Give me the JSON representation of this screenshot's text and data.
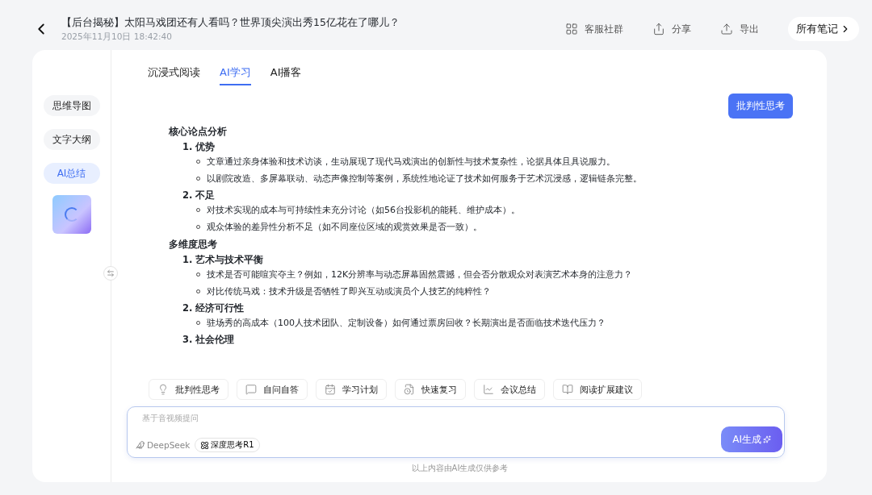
{
  "header": {
    "title": "【后台揭秘】太阳马戏团还有人看吗？世界顶尖演出秀15亿花在了哪儿？",
    "date": "2025年11月10日 18:42:40",
    "actions": [
      {
        "label": "客服社群"
      },
      {
        "label": "分享"
      },
      {
        "label": "导出"
      }
    ],
    "all_notes": "所有笔记"
  },
  "sidebar": {
    "items": [
      {
        "label": "思维导图",
        "selected": false
      },
      {
        "label": "文字大纲",
        "selected": false
      },
      {
        "label": "AI总结",
        "selected": true
      }
    ]
  },
  "tabs": [
    {
      "label": "沉浸式阅读",
      "selected": false
    },
    {
      "label": "AI学习",
      "selected": true
    },
    {
      "label": "AI播客",
      "selected": false
    }
  ],
  "user_message": "批判性思考",
  "sections": [
    {
      "heading": "核心论点分析",
      "children": [
        {
          "marker": "1.",
          "title": "优势",
          "children": [
            {
              "text": "文章通过亲身体验和技术访谈，生动展现了现代马戏演出的创新性与技术复杂性，论据具体且具说服力。"
            },
            {
              "text": "以剧院改造、多屏幕联动、动态声像控制等案例，系统性地论证了技术如何服务于艺术沉浸感，逻辑链条完整。"
            }
          ]
        },
        {
          "marker": "2.",
          "title": "不足",
          "children": [
            {
              "text": "对技术实现的成本与可持续性未充分讨论（如56台投影机的能耗、维护成本）。"
            },
            {
              "text": "观众体验的差异性分析不足（如不同座位区域的观赏效果是否一致）。"
            }
          ]
        }
      ]
    },
    {
      "heading": "多维度思考",
      "children": [
        {
          "marker": "1.",
          "title": "艺术与技术平衡",
          "children": [
            {
              "text": "技术是否可能喧宾夺主？例如，12K分辨率与动态屏幕固然震撼，但会否分散观众对表演艺术本身的注意力？"
            },
            {
              "text": "对比传统马戏：技术升级是否牺牲了即兴互动或演员个人技艺的纯粹性？"
            }
          ]
        },
        {
          "marker": "2.",
          "title": "经济可行性",
          "children": [
            {
              "text": "驻场秀的高成本（100人技术团队、定制设备）如何通过票房回收？长期演出是否面临技术迭代压力？"
            }
          ]
        },
        {
          "marker": "3.",
          "title": "社会伦理"
        }
      ]
    }
  ],
  "quick_actions": [
    {
      "label": "批判性思考"
    },
    {
      "label": "自问自答"
    },
    {
      "label": "学习计划"
    },
    {
      "label": "快速复习"
    },
    {
      "label": "会议总结"
    },
    {
      "label": "阅读扩展建议"
    }
  ],
  "input": {
    "placeholder": "基于音视频提问",
    "model": "DeepSeek",
    "mode": "深度思考R1",
    "submit": "AI生成"
  },
  "footer_note": "以上内容由AI生成仅供参考"
}
